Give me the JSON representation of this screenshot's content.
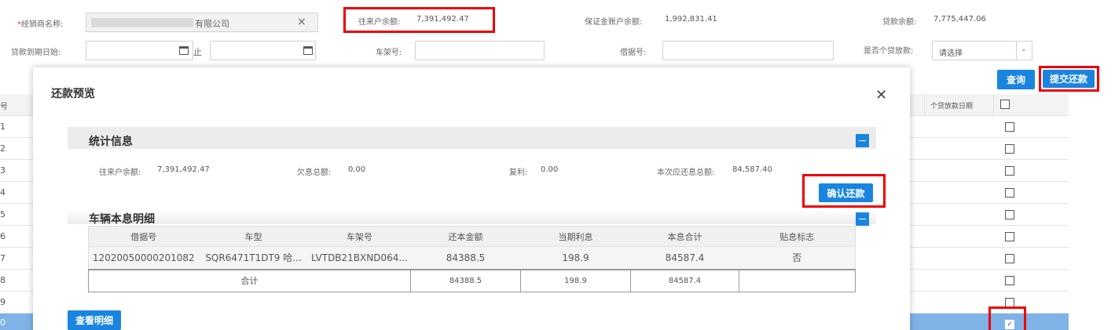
{
  "filters": {
    "dealer_name_label": "经销商名称:",
    "dealer_name_required_mark": "*",
    "dealer_name_value": "有限公司",
    "clear_icon": "×",
    "current_account_label": "往来户余额:",
    "current_account_value": "7,391,492.47",
    "deposit_label": "保证金账户余额:",
    "deposit_value": "1,992,831.41",
    "loan_balance_label": "贷款余额:",
    "loan_balance_value": "7,775,447.06",
    "due_date_start_label": "贷款到期日始:",
    "due_date_end_label": "止",
    "vin_label": "车架号:",
    "receipt_label": "借据号:",
    "personal_loan_label": "是否个贷放款:",
    "personal_loan_select": "请选择",
    "query_button": "查询",
    "submit_button": "提交还款"
  },
  "bg_table": {
    "col_index_header": "号",
    "col_date_header": "个贷放款日期",
    "row_numbers": [
      "1",
      "2",
      "3",
      "4",
      "5",
      "6",
      "7",
      "8",
      "9",
      "0"
    ]
  },
  "modal": {
    "title": "还款预览",
    "close_icon": "✕",
    "stats_title": "统计信息",
    "stats": {
      "current_label": "往来户余额:",
      "current_value": "7,391,492.47",
      "owed_label": "欠息总额:",
      "owed_value": "0.00",
      "compound_label": "复利:",
      "compound_value": "0.00",
      "due_label": "本次应还息总额:",
      "due_value": "84,587.40"
    },
    "confirm_button": "确认还款",
    "detail_title": "车辆本息明细",
    "columns": [
      "借据号",
      "车型",
      "车架号",
      "还本金额",
      "当期利息",
      "本息合计",
      "贴息标志"
    ],
    "rows": [
      [
        "12020050000201082",
        "SQR6471T1DT9 哈...",
        "LVTDB21BXND064...",
        "84388.5",
        "198.9",
        "84587.4",
        "否"
      ]
    ],
    "total": {
      "label": "合计",
      "principal": "84388.5",
      "interest": "198.9",
      "sum": "84587.4"
    },
    "view_detail_button": "查看明细"
  },
  "colors": {
    "accent": "#1a85e0",
    "highlight": "#e00000",
    "selected_row": "#7fb2e6"
  }
}
